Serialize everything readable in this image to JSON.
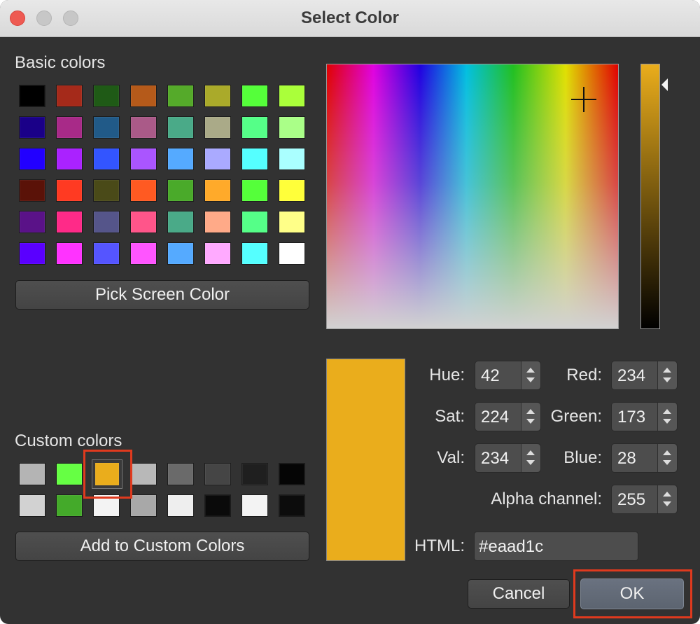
{
  "window": {
    "title": "Select Color"
  },
  "basic_colors": {
    "label": "Basic colors",
    "swatches": [
      "#000000",
      "#a52a1a",
      "#1f5a16",
      "#b55a1a",
      "#55aa2a",
      "#aaaa2a",
      "#55ff3a",
      "#aaff3a",
      "#1a0088",
      "#a82a88",
      "#215a88",
      "#aa5a88",
      "#4aaa88",
      "#aaaa88",
      "#55ff88",
      "#aaff88",
      "#2200ff",
      "#aa22ff",
      "#3355ff",
      "#aa55ff",
      "#55aaff",
      "#aaaaff",
      "#55ffff",
      "#aaffff",
      "#5a1208",
      "#ff3a22",
      "#4a4a18",
      "#ff5a22",
      "#4aaa2a",
      "#ffaa2a",
      "#55ff3a",
      "#ffff3a",
      "#5a1288",
      "#ff2a88",
      "#55558a",
      "#ff558a",
      "#4aaa88",
      "#ffaa88",
      "#55ff88",
      "#ffff88",
      "#5a00ff",
      "#ff33ff",
      "#5555ff",
      "#ff55ff",
      "#55aaff",
      "#ffaaff",
      "#55ffff",
      "#ffffff"
    ]
  },
  "pick_screen_label": "Pick Screen Color",
  "custom_colors": {
    "label": "Custom colors",
    "swatches": [
      "#b4b4b4",
      "#66ff44",
      "#eaad1c",
      "#b8b8b8",
      "#6a6a6a",
      "#454545",
      "#1f1f1f",
      "#050505",
      "#d2d2d2",
      "#44aa2a",
      "#f3f3f3",
      "#a8a8a8",
      "#eeeeee",
      "#0a0a0a",
      "#f3f3f3",
      "#0c0c0c"
    ],
    "selected_index": 2
  },
  "add_custom_label": "Add to Custom Colors",
  "fields": {
    "hue": {
      "label": "Hue:",
      "value": "42"
    },
    "sat": {
      "label": "Sat:",
      "value": "224"
    },
    "val": {
      "label": "Val:",
      "value": "234"
    },
    "red": {
      "label": "Red:",
      "value": "234"
    },
    "green": {
      "label": "Green:",
      "value": "173"
    },
    "blue": {
      "label": "Blue:",
      "value": "28"
    },
    "alpha": {
      "label": "Alpha channel:",
      "value": "255"
    }
  },
  "html": {
    "label": "HTML:",
    "value": "#eaad1c"
  },
  "current_color": "#eaad1c",
  "buttons": {
    "cancel": "Cancel",
    "ok": "OK"
  }
}
